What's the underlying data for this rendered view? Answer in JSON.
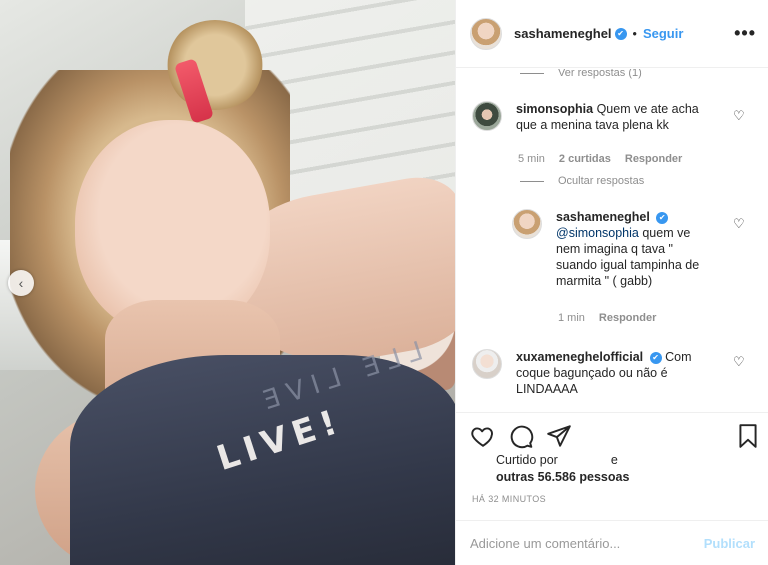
{
  "photo": {
    "shirt_text": "LIVE!",
    "shirt_print": "ƎVI⅃ Ǝ⅃⅃"
  },
  "header": {
    "username": "sashameneghel",
    "dot": "•",
    "follow_label": "Seguir",
    "more_icon": "more-dots-icon"
  },
  "comments": {
    "view_replies": "Ver respostas (1)",
    "items": [
      {
        "username": "simonsophia",
        "text": "Quem ve ate acha que a menina tava plena kk",
        "time": "5 min",
        "likes": "2 curtidas",
        "reply_label": "Responder"
      }
    ],
    "hide_replies": "Ocultar respostas",
    "reply": {
      "username": "sashameneghel",
      "mention": "@simonsophia",
      "text": " quem ve nem imagina q tava \" suando igual tampinha de marmita \" ( gabb)",
      "time": "1 min",
      "reply_label": "Responder"
    },
    "third": {
      "username": "xuxameneghelofficial",
      "text": "Com coque bagunçado ou não é LINDAAAA"
    }
  },
  "likes": {
    "prefix": "Curtido por",
    "suffix": "e",
    "others": "outras 56.586 pessoas"
  },
  "time_ago": "HÁ 32 MINUTOS",
  "add_comment": {
    "placeholder": "Adicione um comentário...",
    "publish_label": "Publicar"
  },
  "colors": {
    "accent": "#3897f0",
    "publish_disabled": "#b2dffc",
    "muted": "#8e8e8e"
  }
}
